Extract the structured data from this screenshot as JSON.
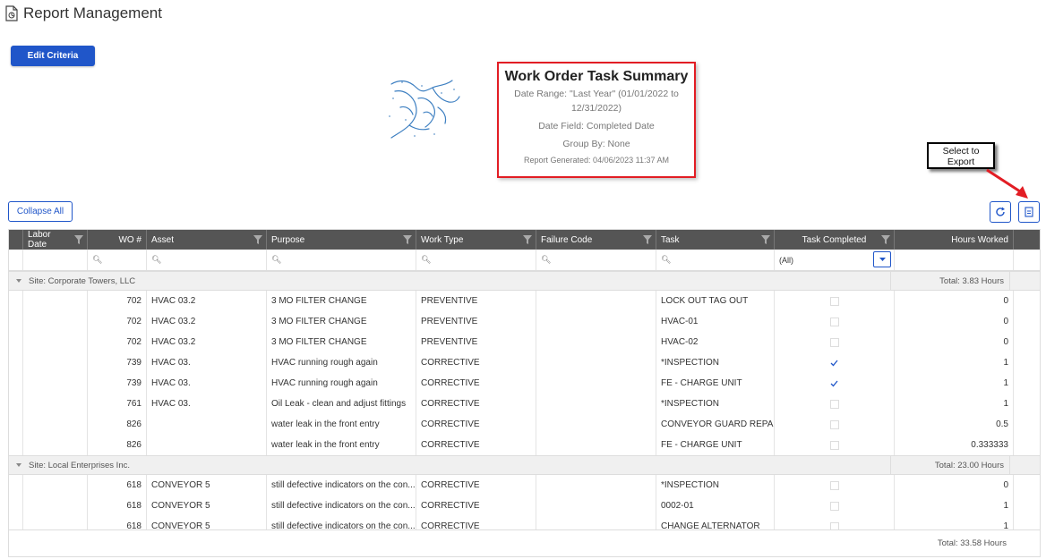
{
  "page": {
    "title": "Report Management"
  },
  "toolbar": {
    "edit_criteria": "Edit Criteria",
    "collapse_all": "Collapse All"
  },
  "summary": {
    "title": "Work Order Task Summary",
    "date_range": "Date Range: \"Last Year\" (01/01/2022 to 12/31/2022)",
    "date_field": "Date Field: Completed Date",
    "group_by": "Group By: None",
    "generated": "Report Generated: 04/06/2023 11:37 AM"
  },
  "callout": {
    "text": "Select to Export"
  },
  "colors": {
    "accent": "#2056c9",
    "header_bg": "#555555",
    "highlight": "#e21d24",
    "group_bg": "#f0f0f0"
  },
  "grid": {
    "columns": [
      "Labor Date",
      "WO #",
      "Asset",
      "Purpose",
      "Work Type",
      "Failure Code",
      "Task",
      "Task Completed",
      "Hours Worked"
    ],
    "task_completed_filter": "(All)",
    "groups": [
      {
        "label": "Site: Corporate Towers, LLC",
        "total": "Total: 3.83 Hours",
        "rows": [
          {
            "labor_date": "",
            "wo": "702",
            "asset": "HVAC 03.2",
            "purpose": "3 MO FILTER CHANGE",
            "work_type": "PREVENTIVE",
            "failure_code": "",
            "task": "LOCK OUT TAG OUT",
            "completed": false,
            "hours": "0"
          },
          {
            "labor_date": "",
            "wo": "702",
            "asset": "HVAC 03.2",
            "purpose": "3 MO FILTER CHANGE",
            "work_type": "PREVENTIVE",
            "failure_code": "",
            "task": "HVAC-01",
            "completed": false,
            "hours": "0"
          },
          {
            "labor_date": "",
            "wo": "702",
            "asset": "HVAC 03.2",
            "purpose": "3 MO FILTER CHANGE",
            "work_type": "PREVENTIVE",
            "failure_code": "",
            "task": "HVAC-02",
            "completed": false,
            "hours": "0"
          },
          {
            "labor_date": "",
            "wo": "739",
            "asset": "HVAC 03.",
            "purpose": "HVAC running rough again",
            "work_type": "CORRECTIVE",
            "failure_code": "",
            "task": "*INSPECTION",
            "completed": true,
            "hours": "1"
          },
          {
            "labor_date": "",
            "wo": "739",
            "asset": "HVAC 03.",
            "purpose": "HVAC running rough again",
            "work_type": "CORRECTIVE",
            "failure_code": "",
            "task": "FE - CHARGE UNIT",
            "completed": true,
            "hours": "1"
          },
          {
            "labor_date": "",
            "wo": "761",
            "asset": "HVAC 03.",
            "purpose": "Oil Leak - clean and adjust fittings",
            "work_type": "CORRECTIVE",
            "failure_code": "",
            "task": "*INSPECTION",
            "completed": false,
            "hours": "1"
          },
          {
            "labor_date": "",
            "wo": "826",
            "asset": "",
            "purpose": "water leak in the front entry",
            "work_type": "CORRECTIVE",
            "failure_code": "",
            "task": "CONVEYOR GUARD REPAIR",
            "completed": false,
            "hours": "0.5"
          },
          {
            "labor_date": "",
            "wo": "826",
            "asset": "",
            "purpose": "water leak in the front entry",
            "work_type": "CORRECTIVE",
            "failure_code": "",
            "task": "FE - CHARGE UNIT",
            "completed": false,
            "hours": "0.333333"
          }
        ]
      },
      {
        "label": "Site: Local Enterprises Inc.",
        "total": "Total: 23.00 Hours",
        "rows": [
          {
            "labor_date": "",
            "wo": "618",
            "asset": "CONVEYOR 5",
            "purpose": "still defective indicators on the con...",
            "work_type": "CORRECTIVE",
            "failure_code": "",
            "task": "*INSPECTION",
            "completed": false,
            "hours": "0"
          },
          {
            "labor_date": "",
            "wo": "618",
            "asset": "CONVEYOR 5",
            "purpose": "still defective indicators on the con...",
            "work_type": "CORRECTIVE",
            "failure_code": "",
            "task": "0002-01",
            "completed": false,
            "hours": "1"
          },
          {
            "labor_date": "",
            "wo": "618",
            "asset": "CONVEYOR 5",
            "purpose": "still defective indicators on the con...",
            "work_type": "CORRECTIVE",
            "failure_code": "",
            "task": "CHANGE ALTERNATOR",
            "completed": false,
            "hours": "1"
          }
        ]
      }
    ],
    "grand_total": "Total: 33.58 Hours"
  }
}
